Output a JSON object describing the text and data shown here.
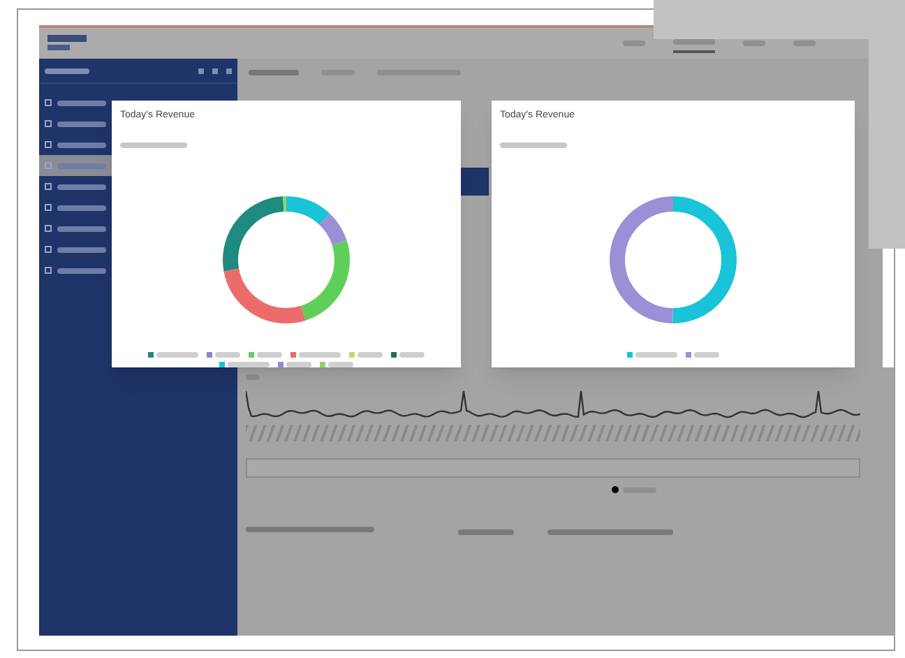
{
  "header_tabs": [
    {
      "selected": false
    },
    {
      "selected": true
    },
    {
      "selected": false
    },
    {
      "selected": false
    }
  ],
  "sidebar": {
    "items": [
      {
        "selected": false
      },
      {
        "selected": false
      },
      {
        "selected": false
      },
      {
        "selected": true
      },
      {
        "selected": false
      },
      {
        "selected": false
      },
      {
        "selected": false
      },
      {
        "selected": false
      },
      {
        "selected": false
      }
    ]
  },
  "cards": [
    {
      "title": "Today's Revenue",
      "segments": [
        {
          "color": "#19c3d8"
        },
        {
          "color": "#9b8fd6"
        },
        {
          "color": "#5fcf5a"
        },
        {
          "color": "#ec6b6b"
        },
        {
          "color": "#1f8a82"
        },
        {
          "color": "#8ed86a"
        }
      ],
      "legend": [
        {
          "color": "#1f8a82"
        },
        {
          "color": "#8c82cc"
        },
        {
          "color": "#5fcf5a"
        },
        {
          "color": "#ec6b6b"
        },
        {
          "color": "#c6d66a"
        },
        {
          "color": "#1f6f6a"
        },
        {
          "color": "#19c3d8"
        },
        {
          "color": "#8c8ce0"
        },
        {
          "color": "#8ed86a"
        }
      ]
    },
    {
      "title": "Today's Revenue",
      "segments": [
        {
          "color": "#19c3d8"
        },
        {
          "color": "#9b8fd6"
        }
      ],
      "legend": [
        {
          "color": "#19c3d8"
        },
        {
          "color": "#9b8fd6"
        }
      ]
    }
  ]
}
